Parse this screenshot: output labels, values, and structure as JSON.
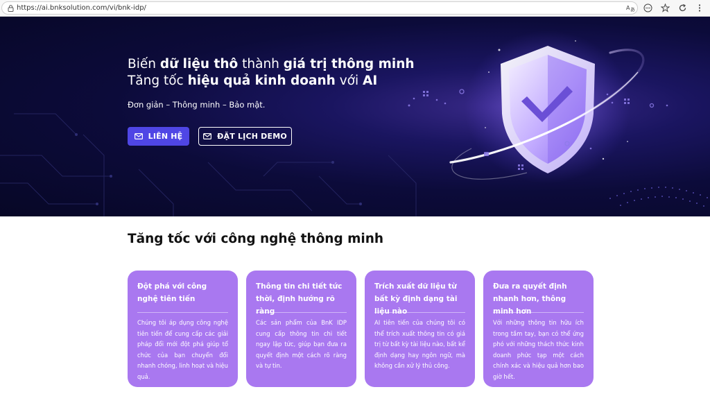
{
  "browser": {
    "url": "https://ai.bnksolution.com/vi/bnk-idp/"
  },
  "hero": {
    "title_line1": [
      {
        "text": "Biến ",
        "bold": false
      },
      {
        "text": "dữ liệu thô",
        "bold": true
      },
      {
        "text": " thành ",
        "bold": false
      },
      {
        "text": "giá trị thông minh",
        "bold": true
      }
    ],
    "title_line2": [
      {
        "text": "Tăng tốc ",
        "bold": false
      },
      {
        "text": "hiệu quả kinh doanh",
        "bold": true
      },
      {
        "text": " với ",
        "bold": false
      },
      {
        "text": "AI",
        "bold": true
      }
    ],
    "tagline": "Đơn giản – Thông minh – Bảo mật.",
    "contact_button": "LIÊN HỆ",
    "demo_button": "ĐẶT LỊCH DEMO"
  },
  "section": {
    "title": "Tăng tốc với công nghệ thông minh",
    "cards": [
      {
        "title": "Đột phá với công nghệ tiên tiến",
        "body": "Chúng tôi áp dụng công nghệ tiên tiến để cung cấp các giải pháp đổi mới đột phá giúp tổ chức của bạn chuyển đổi nhanh chóng, linh hoạt và hiệu quả."
      },
      {
        "title": "Thông tin chi tiết tức thời, định hướng rõ ràng",
        "body": "Các sản phẩm của BnK IDP cung cấp thông tin chi tiết ngay lập tức, giúp bạn đưa ra quyết định một cách rõ ràng và tự tin."
      },
      {
        "title": "Trích xuất dữ liệu từ bất kỳ định dạng tài liệu nào",
        "body": "AI tiên tiến của chúng tôi có thể trích xuất thông tin có giá trị từ bất kỳ tài liệu nào, bất kể định dạng hay ngôn ngữ, mà không cần xử lý thủ công."
      },
      {
        "title": "Đưa ra quyết định nhanh hơn, thông minh hơn",
        "body": "Với những thông tin hữu ích trong tầm tay, bạn có thể ứng phó với những thách thức kinh doanh phức tạp một cách chính xác và hiệu quả hơn bao giờ hết."
      }
    ]
  },
  "colors": {
    "primary_button": "#4f46e5",
    "card_bg": "#a978f0",
    "hero_bg": "#0c0b3a"
  },
  "icons": [
    "lock-icon",
    "translate-icon",
    "more-icon",
    "star-icon",
    "refresh-icon",
    "shield-check-icon",
    "mail-icon"
  ]
}
